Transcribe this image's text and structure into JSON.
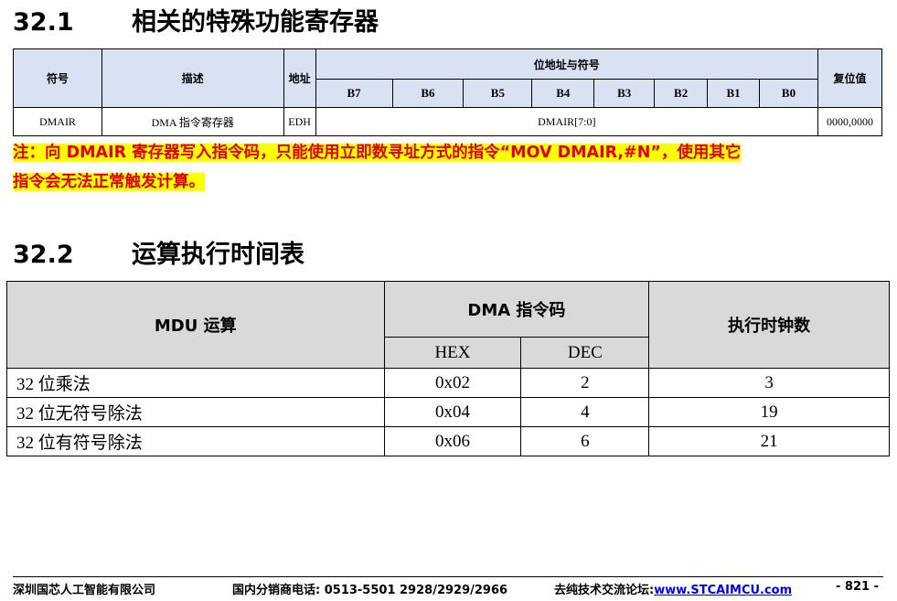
{
  "section1": {
    "number": "32.1",
    "title": "相关的特殊功能寄存器"
  },
  "sfr_table": {
    "headers": {
      "symbol": "符号",
      "description": "描述",
      "address": "地址",
      "bits_group": "位地址与符号",
      "reset": "复位值"
    },
    "bits": [
      "B7",
      "B6",
      "B5",
      "B4",
      "B3",
      "B2",
      "B1",
      "B0"
    ],
    "row": {
      "symbol": "DMAIR",
      "description": "DMA 指令寄存器",
      "address": "EDH",
      "bits_value": "DMAIR[7:0]",
      "reset": "0000,0000"
    }
  },
  "note": {
    "line1": "注：向 DMAIR 寄存器写入指令码，只能使用立即数寻址方式的指令“MOV DMAIR,#N”，使用其它",
    "line2": "指令会无法正常触发计算。"
  },
  "section2": {
    "number": "32.2",
    "title": "运算执行时间表"
  },
  "timing_table": {
    "headers": {
      "op": "MDU 运算",
      "code": "DMA 指令码",
      "hex": "HEX",
      "dec": "DEC",
      "clocks": "执行时钟数"
    },
    "rows": [
      {
        "op": "32 位乘法",
        "hex": "0x02",
        "dec": "2",
        "clocks": "3"
      },
      {
        "op": "32 位无符号除法",
        "hex": "0x04",
        "dec": "4",
        "clocks": "19"
      },
      {
        "op": "32 位有符号除法",
        "hex": "0x06",
        "dec": "6",
        "clocks": "21"
      }
    ]
  },
  "footer": {
    "company": "深圳国芯人工智能有限公司",
    "phone": "国内分销商电话: 0513-5501 2928/2929/2966",
    "forum_label": "去纯技术交流论坛:",
    "forum_link": "www.STCAIMCU.com",
    "page": "- 821 -"
  }
}
